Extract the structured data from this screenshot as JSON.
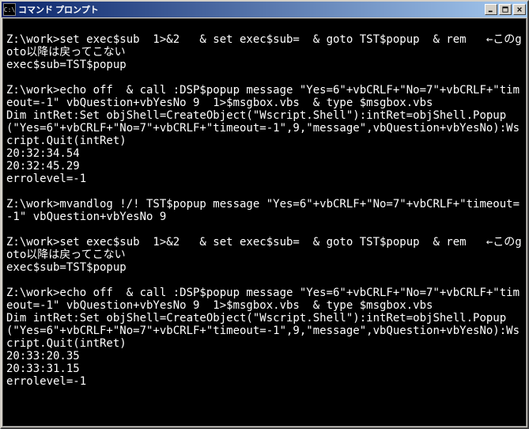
{
  "window": {
    "title": "コマンド プロンプト",
    "icon_text": "C:\\"
  },
  "console": {
    "lines": [
      "",
      "Z:\\work>set exec$sub  1>&2   & set exec$sub=  & goto TST$popup  & rem   ←このgoto以降は戻ってこない",
      "exec$sub=TST$popup",
      "",
      "Z:\\work>echo off  & call :DSP$popup message \"Yes=6\"+vbCRLF+\"No=7\"+vbCRLF+\"timeout=-1\" vbQuestion+vbYesNo 9  1>$msgbox.vbs  & type $msgbox.vbs",
      "Dim intRet:Set objShell=CreateObject(\"Wscript.Shell\"):intRet=objShell.Popup(\"Yes=6\"+vbCRLF+\"No=7\"+vbCRLF+\"timeout=-1\",9,\"message\",vbQuestion+vbYesNo):Wscript.Quit(intRet)",
      "20:32:34.54",
      "20:32:45.29",
      "errolevel=-1",
      "",
      "Z:\\work>mvandlog !/! TST$popup message \"Yes=6\"+vbCRLF+\"No=7\"+vbCRLF+\"timeout=-1\" vbQuestion+vbYesNo 9",
      "",
      "Z:\\work>set exec$sub  1>&2   & set exec$sub=  & goto TST$popup  & rem   ←このgoto以降は戻ってこない",
      "exec$sub=TST$popup",
      "",
      "Z:\\work>echo off  & call :DSP$popup message \"Yes=6\"+vbCRLF+\"No=7\"+vbCRLF+\"timeout=-1\" vbQuestion+vbYesNo 9  1>$msgbox.vbs  & type $msgbox.vbs",
      "Dim intRet:Set objShell=CreateObject(\"Wscript.Shell\"):intRet=objShell.Popup(\"Yes=6\"+vbCRLF+\"No=7\"+vbCRLF+\"timeout=-1\",9,\"message\",vbQuestion+vbYesNo):Wscript.Quit(intRet)",
      "20:33:20.35",
      "20:33:31.15",
      "errolevel=-1"
    ]
  }
}
